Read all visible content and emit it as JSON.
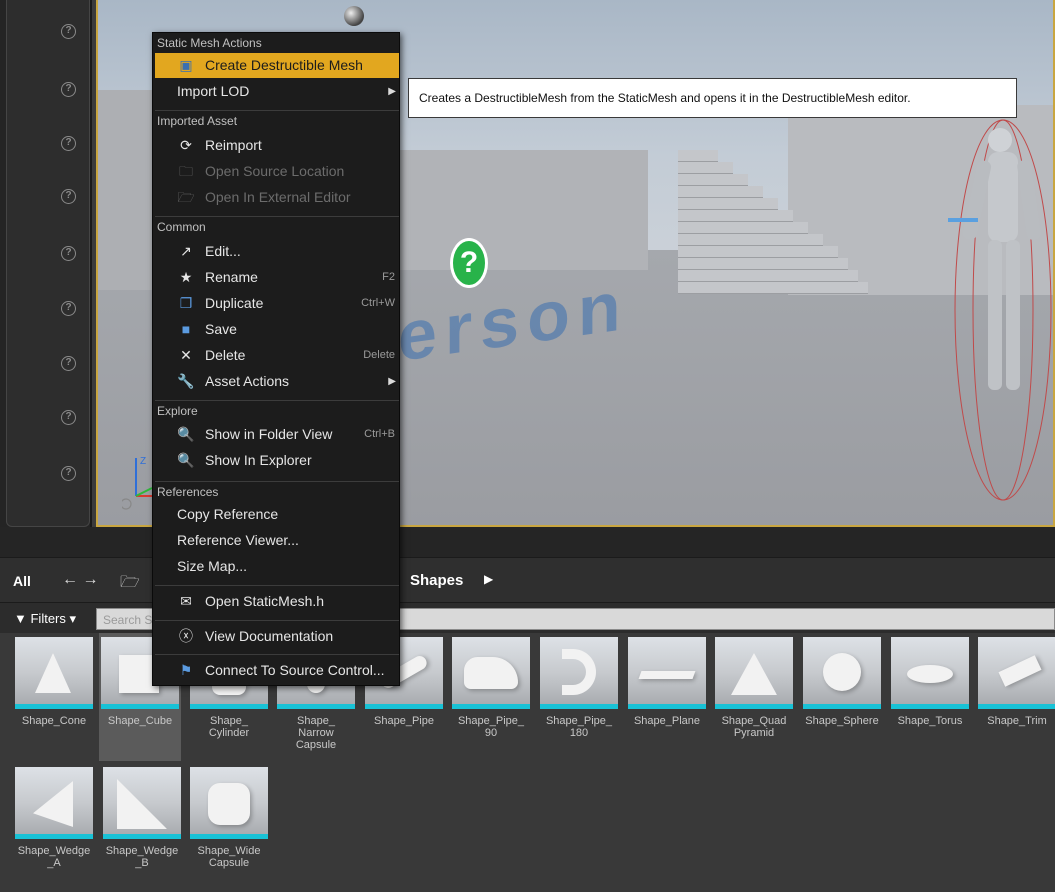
{
  "context_menu": {
    "sections": {
      "static_mesh_actions": "Static Mesh Actions",
      "imported_asset": "Imported Asset",
      "common": "Common",
      "explore": "Explore",
      "references": "References"
    },
    "items": {
      "create_destructible_mesh": "Create Destructible Mesh",
      "import_lod": "Import LOD",
      "reimport": "Reimport",
      "open_source_location": "Open Source Location",
      "open_in_external_editor": "Open In External Editor",
      "edit": "Edit...",
      "rename": "Rename",
      "rename_shortcut": "F2",
      "duplicate": "Duplicate",
      "duplicate_shortcut": "Ctrl+W",
      "save": "Save",
      "delete": "Delete",
      "delete_shortcut": "Delete",
      "asset_actions": "Asset Actions",
      "show_in_folder_view": "Show in Folder View",
      "show_in_folder_view_shortcut": "Ctrl+B",
      "show_in_explorer": "Show In Explorer",
      "copy_reference": "Copy Reference",
      "reference_viewer": "Reference Viewer...",
      "size_map": "Size Map...",
      "open_header": "Open StaticMesh.h",
      "view_documentation": "View Documentation",
      "connect_source_control": "Connect To Source Control..."
    }
  },
  "tooltip": "Creates a DestructibleMesh from the StaticMesh and opens it in the DestructibleMesh editor.",
  "content_browser": {
    "all_label": "All",
    "path_label": "Shapes",
    "filters_label": "Filters",
    "search_placeholder": "Search S"
  },
  "assets": [
    "Shape_Cone",
    "Shape_Cube",
    "Shape_\nCylinder",
    "Shape_\nNarrow\nCapsule",
    "Shape_Pipe",
    "Shape_Pipe_\n90",
    "Shape_Pipe_\n180",
    "Shape_Plane",
    "Shape_Quad\nPyramid",
    "Shape_Sphere",
    "Shape_Torus",
    "Shape_Trim",
    "Shape_Wedge\n_A",
    "Shape_Wedge\n_B",
    "Shape_Wide\nCapsule"
  ],
  "viewport": {
    "help_glyph": "?",
    "floor_text": "erson",
    "axis_z": "Z"
  },
  "colors": {
    "menu_highlight": "#e2a71f",
    "asset_underline": "#18c2d6",
    "viewport_border": "#c9a640"
  }
}
